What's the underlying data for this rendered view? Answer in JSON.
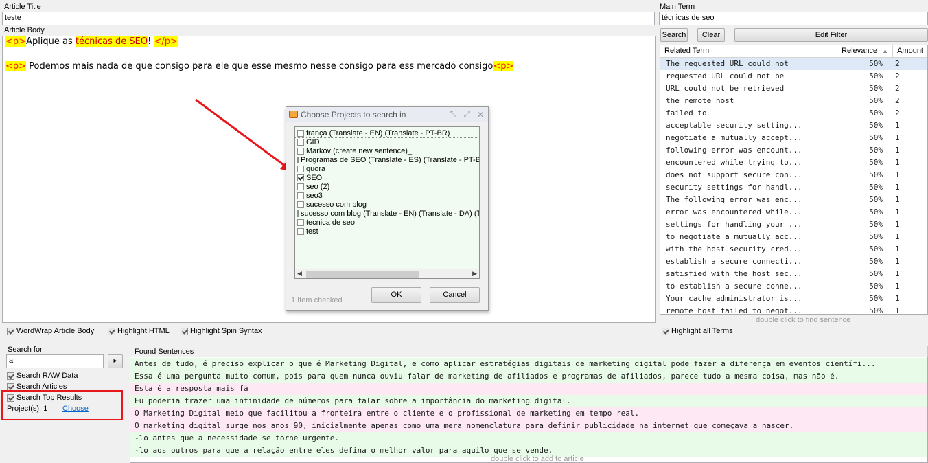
{
  "article_title": {
    "label": "Article Title",
    "value": "teste"
  },
  "main_term": {
    "label": "Main Term",
    "value": "técnicas de seo"
  },
  "article_body": {
    "label": "Article Body",
    "line1": {
      "tag_open": "<p>",
      "text": "Aplique as ",
      "highlight": "técnicas de SEO",
      "after": "! ",
      "tag_close": "</p>"
    },
    "line2": {
      "tag_open": "<p>",
      "text": " Podemos mais nada de que consigo para ele que esse mesmo nesse consigo para ess mercado consigo",
      "tag_close": "<p>"
    }
  },
  "filter": {
    "search_label": "Search",
    "clear_label": "Clear",
    "edit_filter_label": "Edit Filter"
  },
  "related_terms": {
    "columns": [
      "Related Term",
      "Relevance",
      "Amount"
    ],
    "sort_indicator": "▲",
    "rows": [
      {
        "term": "The requested URL could not",
        "relevance": "50%",
        "amount": "2"
      },
      {
        "term": "requested URL could not be",
        "relevance": "50%",
        "amount": "2"
      },
      {
        "term": "URL could not be retrieved",
        "relevance": "50%",
        "amount": "2"
      },
      {
        "term": "the remote host",
        "relevance": "50%",
        "amount": "2"
      },
      {
        "term": "failed to",
        "relevance": "50%",
        "amount": "2"
      },
      {
        "term": "acceptable security setting...",
        "relevance": "50%",
        "amount": "1"
      },
      {
        "term": "negotiate a mutually accept...",
        "relevance": "50%",
        "amount": "1"
      },
      {
        "term": "following error was encount...",
        "relevance": "50%",
        "amount": "1"
      },
      {
        "term": "encountered while trying to...",
        "relevance": "50%",
        "amount": "1"
      },
      {
        "term": "does not support secure con...",
        "relevance": "50%",
        "amount": "1"
      },
      {
        "term": "security settings for handl...",
        "relevance": "50%",
        "amount": "1"
      },
      {
        "term": "The following error was enc...",
        "relevance": "50%",
        "amount": "1"
      },
      {
        "term": "error was encountered while...",
        "relevance": "50%",
        "amount": "1"
      },
      {
        "term": "settings for handling your ...",
        "relevance": "50%",
        "amount": "1"
      },
      {
        "term": "to negotiate a mutually acc...",
        "relevance": "50%",
        "amount": "1"
      },
      {
        "term": "with the host security cred...",
        "relevance": "50%",
        "amount": "1"
      },
      {
        "term": "establish a secure connecti...",
        "relevance": "50%",
        "amount": "1"
      },
      {
        "term": "satisfied with the host sec...",
        "relevance": "50%",
        "amount": "1"
      },
      {
        "term": "to establish a secure conne...",
        "relevance": "50%",
        "amount": "1"
      },
      {
        "term": "Your cache administrator is...",
        "relevance": "50%",
        "amount": "1"
      },
      {
        "term": "remote host failed to negot...",
        "relevance": "50%",
        "amount": "1"
      }
    ],
    "hint": "double click to find sentence"
  },
  "options": {
    "wordwrap": "WordWrap Article Body",
    "highlight_html": "Highlight HTML",
    "highlight_spin": "Highlight Spin Syntax",
    "highlight_terms": "Highlight all Terms"
  },
  "search_panel": {
    "search_for_label": "Search for",
    "search_value": "a",
    "go_glyph": "▸",
    "search_raw": "Search RAW Data",
    "search_articles": "Search Articles",
    "search_top": "Search Top Results",
    "projects_label": "Project(s):",
    "projects_count": "1",
    "choose_label": "Choose"
  },
  "found_sentences": {
    "label": "Found Sentences",
    "rows": [
      {
        "text": " Antes de tudo, é preciso explicar o que é Marketing Digital, e como aplicar estratégias digitais de marketing digital pode fazer a diferença em eventos científi...",
        "color": "#e8fbe8"
      },
      {
        "text": " Essa é uma pergunta muito comum, pois para quem nunca ouviu falar de marketing de afiliados e programas de afiliados, parece tudo a mesma coisa, mas não é.",
        "color": "#e8fbe8"
      },
      {
        "text": " Esta é a resposta mais fá",
        "color": "#fde8f4"
      },
      {
        "text": " Eu poderia trazer uma infinidade de números para falar sobre a importância do marketing digital.",
        "color": "#e8fbe8"
      },
      {
        "text": " O Marketing Digital meio que facilitou a fronteira entre o cliente e o profissional de marketing em tempo real.",
        "color": "#fde8f4"
      },
      {
        "text": " O marketing digital surge nos anos 90, inicialmente apenas como uma mera nomenclatura para definir publicidade na internet que começava a nascer.",
        "color": "#fde8f4"
      },
      {
        "text": "-lo antes que a necessidade se torne urgente.",
        "color": "#e8fbe8"
      },
      {
        "text": "-lo aos outros para que a relação entre eles defina o melhor valor para aquilo que se vende.",
        "color": "#e8fbe8"
      }
    ],
    "hint": "double click to add to article"
  },
  "dialog": {
    "title": "Choose Projects to search in",
    "projects": [
      {
        "name": "frança (Translate - EN) (Translate - PT-BR)",
        "checked": false
      },
      {
        "name": "GID",
        "checked": false
      },
      {
        "name": "Markov (create new sentence)_",
        "checked": false
      },
      {
        "name": "Programas de SEO (Translate - ES) (Translate - PT-B",
        "checked": false
      },
      {
        "name": "quora",
        "checked": false
      },
      {
        "name": "SEO",
        "checked": true
      },
      {
        "name": "seo (2)",
        "checked": false
      },
      {
        "name": "seo3",
        "checked": false
      },
      {
        "name": "sucesso com blog",
        "checked": false
      },
      {
        "name": "sucesso com blog (Translate - EN) (Translate - DA) (T",
        "checked": false
      },
      {
        "name": "tecnica de seo",
        "checked": false
      },
      {
        "name": "test",
        "checked": false
      }
    ],
    "status": "1 Item checked",
    "ok_label": "OK",
    "cancel_label": "Cancel"
  },
  "colors": {
    "annotation_red": "#e8171b",
    "link_blue": "#0066cc",
    "selected_row": "#dde9f6"
  }
}
